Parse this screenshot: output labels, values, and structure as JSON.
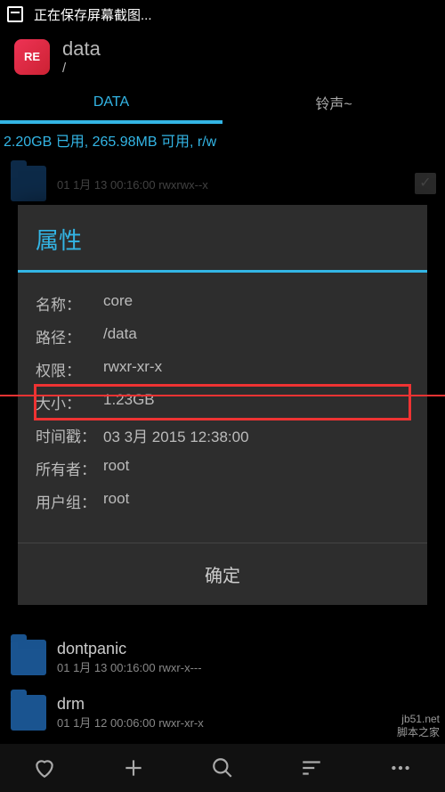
{
  "status": {
    "text": "正在保存屏幕截图..."
  },
  "header": {
    "icon_label": "RE",
    "title": "data",
    "path": "/"
  },
  "tabs": {
    "active": "DATA",
    "other": "铃声~"
  },
  "storage": "2.20GB 已用, 265.98MB 可用, r/w",
  "rows": [
    {
      "name": "",
      "meta": "01 1月 13 00:16:00    rwxrwx--x"
    },
    {
      "name": "dontpanic",
      "meta": "01 1月 13 00:16:00    rwxr-x---"
    },
    {
      "name": "drm",
      "meta": "01 1月 12 00:06:00    rwxr-xr-x"
    }
  ],
  "dialog": {
    "title": "属性",
    "labels": {
      "name": "名称：",
      "path": "路径：",
      "perm": "权限：",
      "size": "大小：",
      "time": "时间戳：",
      "owner": "所有者：",
      "group": "用户组："
    },
    "values": {
      "name": "core",
      "path": "/data",
      "perm": "rwxr-xr-x",
      "size": "1.23GB",
      "time": "03 3月 2015 12:38:00",
      "owner": "root",
      "group": "root"
    },
    "ok": "确定"
  },
  "watermark": {
    "line1": "jb51.net",
    "line2": "脚本之家"
  }
}
